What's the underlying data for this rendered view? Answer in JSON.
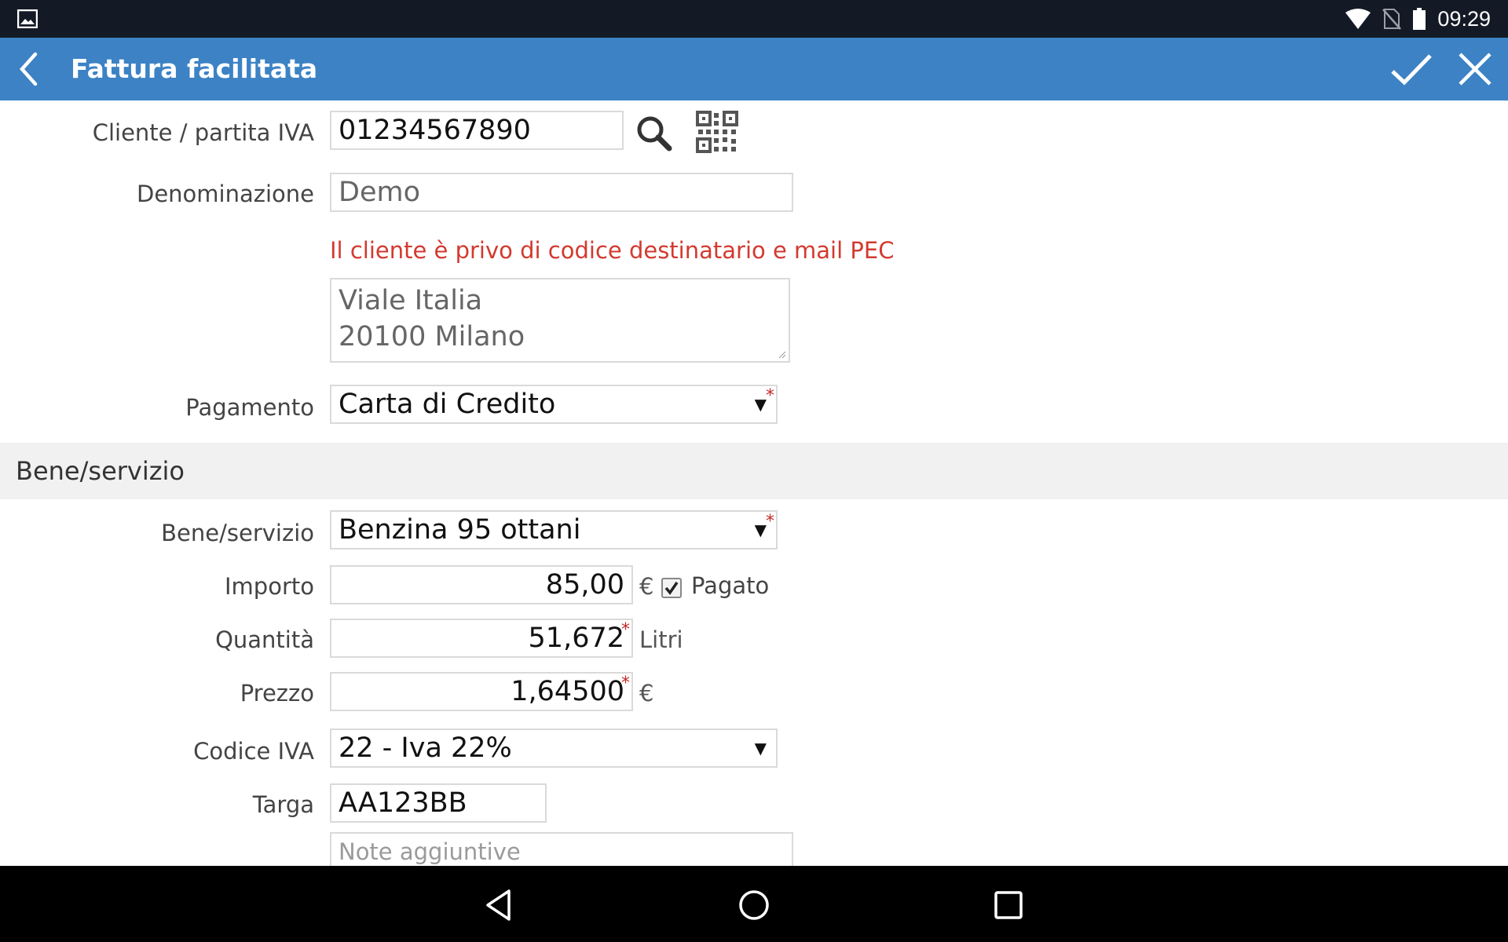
{
  "status_bar": {
    "time": "09:29",
    "icons": [
      "image-icon",
      "wifi-icon",
      "no-sim-icon",
      "battery-icon"
    ]
  },
  "app_bar": {
    "title": "Fattura facilitata",
    "icons": [
      "back-arrow-icon",
      "check-icon",
      "close-icon"
    ],
    "color": "#3c82c5"
  },
  "form": {
    "cliente": {
      "label": "Cliente / partita IVA",
      "value": "01234567890"
    },
    "denominazione": {
      "label": "Denominazione",
      "value": "Demo"
    },
    "warning": "Il cliente è privo di codice destinatario e mail PEC",
    "indirizzo": {
      "line1": "Viale Italia",
      "line2": "20100 Milano"
    },
    "pagamento": {
      "label": "Pagamento",
      "value": "Carta di Credito",
      "required_mark": "*"
    }
  },
  "section": {
    "title": "Bene/servizio"
  },
  "item": {
    "bene": {
      "label": "Bene/servizio",
      "value": "Benzina 95 ottani",
      "required_mark": "*"
    },
    "importo": {
      "label": "Importo",
      "value": "85,00",
      "unit": "€",
      "paid_label": "Pagato",
      "paid_checked": true
    },
    "quantita": {
      "label": "Quantità",
      "value": "51,672",
      "unit": "Litri",
      "required_mark": "*"
    },
    "prezzo": {
      "label": "Prezzo",
      "value": "1,64500",
      "unit": "€",
      "required_mark": "*"
    },
    "codice_iva": {
      "label": "Codice IVA",
      "value": "22 - Iva 22%"
    },
    "targa": {
      "label": "Targa",
      "value": "AA123BB"
    },
    "note": {
      "placeholder": "Note aggiuntive"
    }
  },
  "select_arrow": "▼",
  "colors": {
    "warning": "#d23a2f",
    "required": "#c62828",
    "section_bg": "#f1f1f1"
  }
}
